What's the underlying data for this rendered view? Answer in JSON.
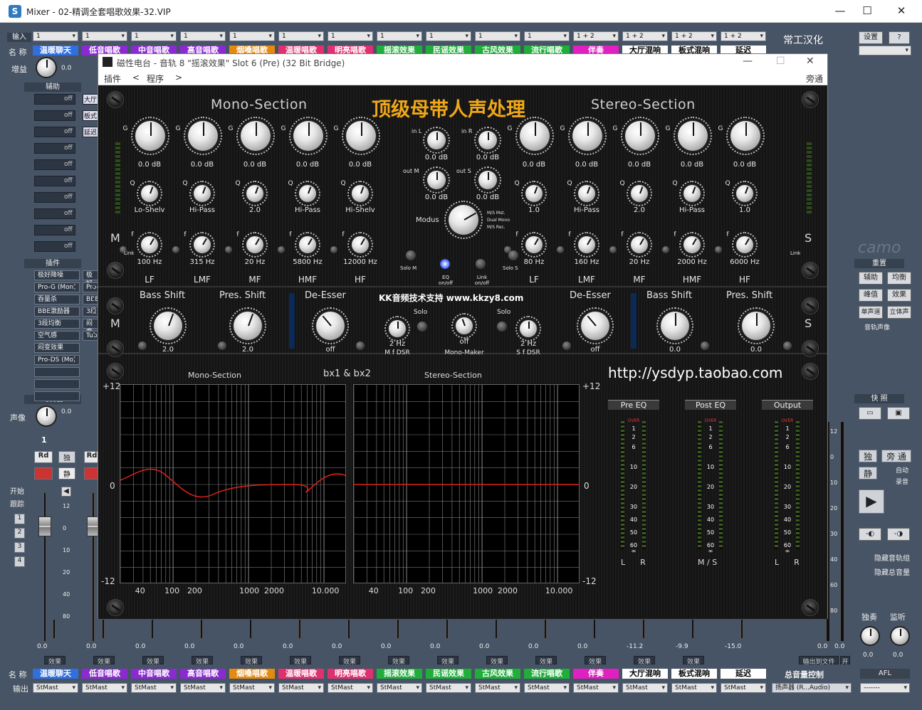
{
  "window": {
    "title": "Mixer - 02-精调全套唱歌效果-32.VIP",
    "app_icon": "S",
    "min": "—",
    "max": "☐",
    "close": "✕"
  },
  "mixer": {
    "left_labels": {
      "input": "输入",
      "name": "名 称",
      "gain": "增益",
      "gain_value": "0.0",
      "aux": "辅助",
      "insert": "插件",
      "eq": "均衡器",
      "pan": "声像",
      "pan_value": "0.0",
      "start": "开始",
      "follow": "跟踪",
      "group_nums": [
        "1",
        "2",
        "3",
        "4"
      ],
      "name_bottom": "名 称",
      "output": "输出"
    },
    "tracks": [
      {
        "input": "1",
        "name": "温暖聊天",
        "color": "#2f6fe0"
      },
      {
        "input": "1",
        "name": "低音唱歌",
        "color": "#8a2ad0"
      },
      {
        "input": "1",
        "name": "中音唱歌",
        "color": "#8a2ad0"
      },
      {
        "input": "1",
        "name": "高音唱歌",
        "color": "#8a2ad0"
      },
      {
        "input": "1",
        "name": "烟嗓唱歌",
        "color": "#e58a10"
      },
      {
        "input": "1",
        "name": "温暖唱歌",
        "color": "#e03070"
      },
      {
        "input": "1",
        "name": "明亮唱歌",
        "color": "#e03070"
      },
      {
        "input": "1",
        "name": "摇滚效果",
        "color": "#1fae3a"
      },
      {
        "input": "1",
        "name": "民谣效果",
        "color": "#1fae3a"
      },
      {
        "input": "1",
        "name": "古风效果",
        "color": "#1fae3a"
      },
      {
        "input": "1",
        "name": "流行唱歌",
        "color": "#1fae3a"
      },
      {
        "input": "1 + 2",
        "name": "伴奏",
        "color": "#e020c0"
      },
      {
        "input": "1 + 2",
        "name": "大厅混响",
        "color": "#ffffff"
      },
      {
        "input": "1 + 2",
        "name": "板式混响",
        "color": "#ffffff"
      },
      {
        "input": "1 + 2",
        "name": "延迟",
        "color": "#ffffff"
      }
    ],
    "aux_off": [
      "off",
      "off",
      "off",
      "off",
      "off",
      "off",
      "off",
      "off",
      "off",
      "off"
    ],
    "track1_inserts": [
      "极好降噪",
      "Pro-G (Mon)",
      "吞量杀",
      "BBE激励器",
      "3段均衡",
      "空气感",
      "闷变效果",
      "Pro-DS (Mo)"
    ],
    "track2_inserts": [
      "极好",
      "Pro-",
      "BBE",
      "3段",
      "闷变",
      "Tube"
    ],
    "track2_aux": [
      "大厅",
      "板式",
      "延迟"
    ],
    "track_num": "1",
    "rd": "Rd",
    "solo": "独",
    "mute": "静",
    "fader_scale": [
      "12",
      "0",
      "10",
      "20",
      "40",
      "80"
    ],
    "bottom_values": [
      "0.0",
      "0.0",
      "0.0",
      "0.0",
      "0.0",
      "0.0",
      "0.0",
      "0.0",
      "0.0",
      "0.0",
      "0.0",
      "0.0",
      "-11.2",
      "-9.9",
      "-15.0"
    ],
    "fx_label": "效果",
    "output": "StMast",
    "master": {
      "title": "常工汉化",
      "settings": "设置",
      "help": "?",
      "reset": "重置",
      "aux": "辅助",
      "eq": "均衡",
      "pan": "峰值",
      "effect": "效果",
      "mono": "单声道",
      "stereo": "立体声",
      "track_pan": "音轨声像",
      "quick": "快 照",
      "solo": "独",
      "bypass": "旁 通",
      "mute": "静",
      "auto": "自动",
      "record": "录音",
      "hide_tracks": "隐藏音轨组",
      "hide_total": "隐藏总音量",
      "scale": [
        "12",
        "0",
        "10",
        "20",
        "30",
        "40",
        "60",
        "80"
      ],
      "out_file": "输出到文件",
      "open": "开",
      "total_volume": "总音量控制",
      "output_dev": "扬声器 (R...Audio)",
      "solo_label": "独奏",
      "monitor": "监听",
      "solo_value": "0.0",
      "monitor_value": "0.0",
      "afl": "AFL",
      "monitor_sel": "-------",
      "vals": [
        "0.0",
        "0.0"
      ],
      "camo": "camo"
    }
  },
  "plugin": {
    "title": "磁性电台 - 音轨 8  \"摇滚效果\" Slot 6 (Pre) (32 Bit Bridge)",
    "menu": {
      "plugin": "插件",
      "prev": "<",
      "program": "程序",
      "next": ">",
      "bypass": "旁通"
    },
    "mono_title": "Mono-Section",
    "stereo_title": "Stereo-Section",
    "banner": "顶级母带人声处理",
    "m_label": "M",
    "s_label": "S",
    "gain_g": "G",
    "q_label": "Q",
    "f_label": "f",
    "link": "Link",
    "mono_gains": [
      "0.0 dB",
      "0.0 dB",
      "0.0 dB",
      "0.0 dB",
      "0.0 dB"
    ],
    "mono_q": [
      "Lo-Shelv",
      "Hi-Pass",
      "2.0",
      "Hi-Pass",
      "Hi-Shelv"
    ],
    "mono_f": [
      "100 Hz",
      "315 Hz",
      "20 Hz",
      "5800 Hz",
      "12000 Hz"
    ],
    "bands": [
      "LF",
      "LMF",
      "MF",
      "HMF",
      "HF"
    ],
    "stereo_gains": [
      "0.0 dB",
      "0.0 dB",
      "0.0 dB",
      "0.0 dB",
      "0.0 dB"
    ],
    "stereo_q": [
      "1.0",
      "Hi-Pass",
      "2.0",
      "Hi-Pass",
      "1.0"
    ],
    "stereo_f": [
      "80 Hz",
      "160 Hz",
      "20 Hz",
      "2000 Hz",
      "6000 Hz"
    ],
    "center": {
      "in_l": "in L",
      "in_r": "in R",
      "out_m": "out M",
      "out_s": "out S",
      "v1": "0.0 dB",
      "v2": "0.0 dB",
      "v3": "0.0 dB",
      "v4": "0.0 dB",
      "modus": "Modus",
      "modes": [
        "M/S Mst.",
        "Dual Mono",
        "M/S Rec."
      ],
      "solo_m": "Solo M",
      "eq_onoff": "EQ on/off",
      "link_onoff": "Link on/off",
      "solo_s": "Solo S"
    },
    "mid": {
      "bass_shift": "Bass Shift",
      "pres_shift": "Pres. Shift",
      "de_esser": "De-Esser",
      "kk": "KK音频技术支持 www.kkzy8.com",
      "solo": "Solo",
      "bass_val": "2.0",
      "pres_val": "2.0",
      "de_val": "off",
      "m_dsr_val": "2 Hz",
      "m_dsr": "M f DSR",
      "mm_val": "off",
      "mono_maker": "Mono-Maker",
      "s_dsr_val": "2 Hz",
      "s_dsr": "S f DSR",
      "s_de_val": "off",
      "s_bass_val": "0.0",
      "s_pres_val": "0.0"
    },
    "graph": {
      "mono": "Mono-Section",
      "bx": "bx1 & bx2",
      "stereo": "Stereo-Section",
      "url": "http://ysdyp.taobao.com",
      "top": "+12",
      "zero": "0",
      "bottom": "-12",
      "x_ticks": [
        "40",
        "100",
        "200",
        "1000",
        "2000",
        "10.000"
      ]
    },
    "meters": {
      "pre": "Pre EQ",
      "post": "Post EQ",
      "output": "Output",
      "over": "OVER",
      "scale": [
        "1",
        "2",
        "6",
        "10",
        "20",
        "30",
        "40",
        "50",
        "60",
        "∞"
      ],
      "pre_lr": "L      R",
      "post_ms": "M / S",
      "out_lr": "L      R"
    }
  }
}
